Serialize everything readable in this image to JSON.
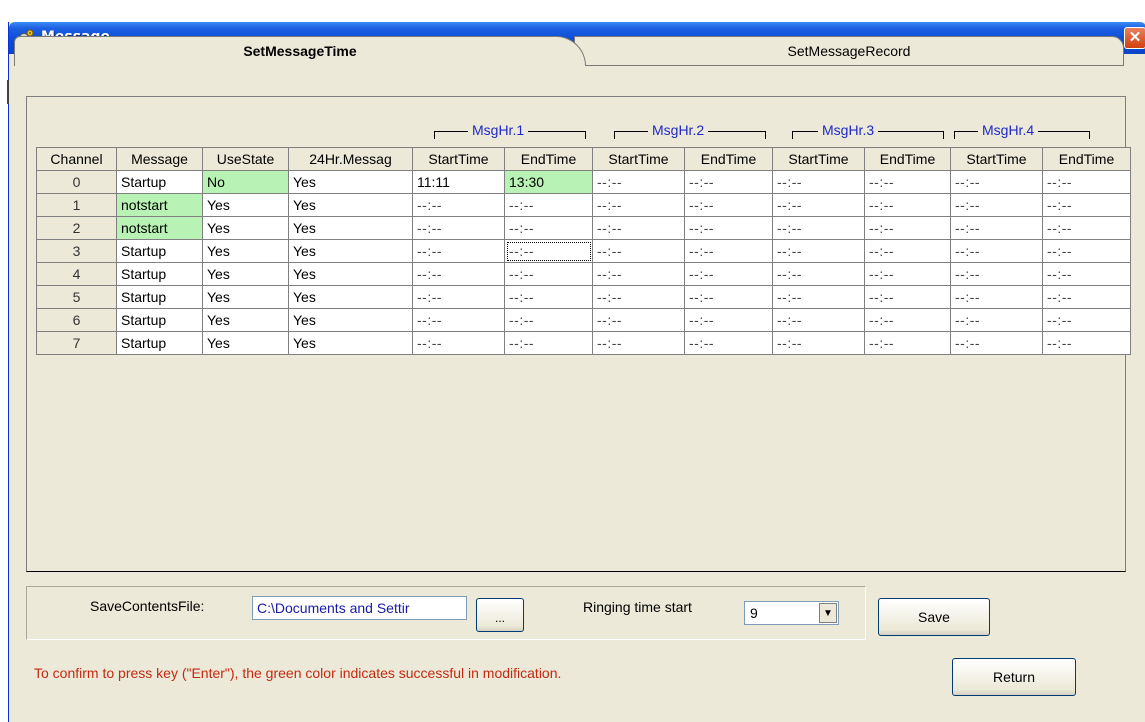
{
  "window": {
    "title": "Message",
    "close_glyph": "✕",
    "icon": "gear-icon"
  },
  "tabs": [
    {
      "label": "SetMessageTime",
      "active": true
    },
    {
      "label": "SetMessageRecord",
      "active": false
    }
  ],
  "groups": [
    "MsgHr.1",
    "MsgHr.2",
    "MsgHr.3",
    "MsgHr.4"
  ],
  "columns": [
    "Channel",
    "Message",
    "UseState",
    "24Hr.Messag",
    "StartTime",
    "EndTime",
    "StartTime",
    "EndTime",
    "StartTime",
    "EndTime",
    "StartTime",
    "EndTime"
  ],
  "rows": [
    {
      "channel": "0",
      "message": "Startup",
      "use_state": "No",
      "hr24": "Yes",
      "times": [
        "11:11",
        "13:30",
        "--:--",
        "--:--",
        "--:--",
        "--:--",
        "--:--",
        "--:--"
      ]
    },
    {
      "channel": "1",
      "message": "notstart",
      "use_state": "Yes",
      "hr24": "Yes",
      "times": [
        "--:--",
        "--:--",
        "--:--",
        "--:--",
        "--:--",
        "--:--",
        "--:--",
        "--:--"
      ]
    },
    {
      "channel": "2",
      "message": "notstart",
      "use_state": "Yes",
      "hr24": "Yes",
      "times": [
        "--:--",
        "--:--",
        "--:--",
        "--:--",
        "--:--",
        "--:--",
        "--:--",
        "--:--"
      ]
    },
    {
      "channel": "3",
      "message": "Startup",
      "use_state": "Yes",
      "hr24": "Yes",
      "times": [
        "--:--",
        "--:--",
        "--:--",
        "--:--",
        "--:--",
        "--:--",
        "--:--",
        "--:--"
      ]
    },
    {
      "channel": "4",
      "message": "Startup",
      "use_state": "Yes",
      "hr24": "Yes",
      "times": [
        "--:--",
        "--:--",
        "--:--",
        "--:--",
        "--:--",
        "--:--",
        "--:--",
        "--:--"
      ]
    },
    {
      "channel": "5",
      "message": "Startup",
      "use_state": "Yes",
      "hr24": "Yes",
      "times": [
        "--:--",
        "--:--",
        "--:--",
        "--:--",
        "--:--",
        "--:--",
        "--:--",
        "--:--"
      ]
    },
    {
      "channel": "6",
      "message": "Startup",
      "use_state": "Yes",
      "hr24": "Yes",
      "times": [
        "--:--",
        "--:--",
        "--:--",
        "--:--",
        "--:--",
        "--:--",
        "--:--",
        "--:--"
      ]
    },
    {
      "channel": "7",
      "message": "Startup",
      "use_state": "Yes",
      "hr24": "Yes",
      "times": [
        "--:--",
        "--:--",
        "--:--",
        "--:--",
        "--:--",
        "--:--",
        "--:--",
        "--:--"
      ]
    }
  ],
  "modified_cells": [
    "0.use_state",
    "0.times.1",
    "1.message",
    "2.message"
  ],
  "bottom": {
    "save_file_label": "SaveContentsFile:",
    "save_file_value": "C:\\Documents and Settir",
    "browse_label": "...",
    "ringing_label": "Ringing time start",
    "ringing_value": "9",
    "save_label": "Save",
    "return_label": "Return"
  },
  "hint": "To confirm to press key (\"Enter\"), the green color indicates successful in modification.",
  "colors": {
    "modified_green": "#b9f2b5",
    "hint_red": "#c42a12",
    "group_blue": "#1f28c8",
    "title_blue": "#0a4bd6"
  }
}
